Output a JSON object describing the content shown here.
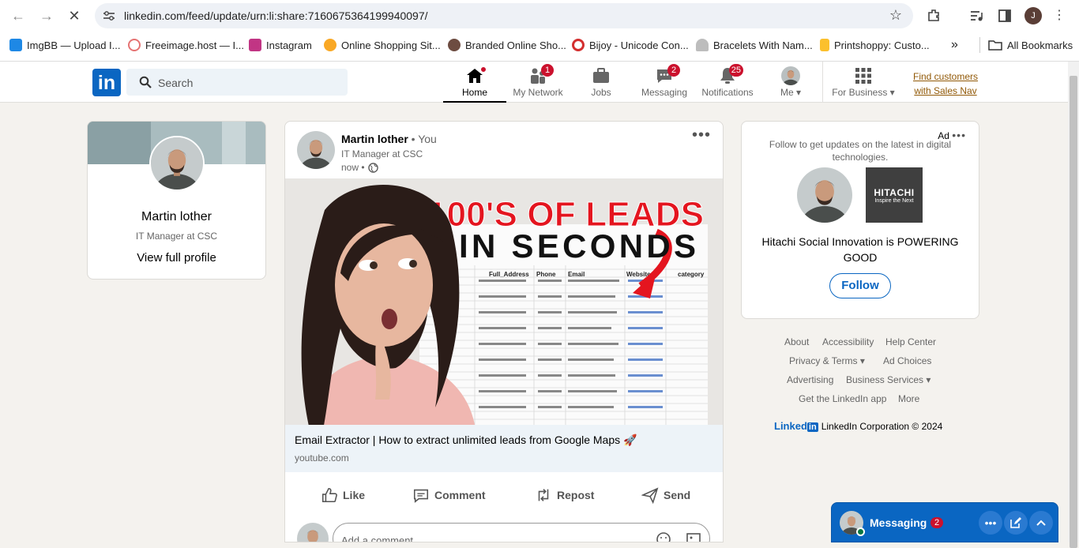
{
  "browser": {
    "url": "linkedin.com/feed/update/urn:li:share:7160675364199940097/",
    "profile_initial": "J",
    "bookmarks": [
      {
        "label": "ImgBB — Upload I...",
        "color": "#1e88e5"
      },
      {
        "label": "Freeimage.host — I...",
        "color": "#e57373"
      },
      {
        "label": "Instagram",
        "color": "#c13584"
      },
      {
        "label": "Online Shopping Sit...",
        "color": "#f9a825"
      },
      {
        "label": "Branded Online Sho...",
        "color": "#6d4c41"
      },
      {
        "label": "Bijoy - Unicode Con...",
        "color": "#d32f2f"
      },
      {
        "label": "Bracelets With Nam...",
        "color": "#9e9e9e"
      },
      {
        "label": "Printshoppy: Custo...",
        "color": "#fbc02d"
      }
    ],
    "all_bookmarks": "All Bookmarks"
  },
  "linkedin": {
    "logo": "in",
    "search_placeholder": "Search",
    "nav": [
      {
        "label": "Home",
        "badge": ""
      },
      {
        "label": "My Network",
        "badge": "1"
      },
      {
        "label": "Jobs",
        "badge": ""
      },
      {
        "label": "Messaging",
        "badge": "2"
      },
      {
        "label": "Notifications",
        "badge": "25"
      },
      {
        "label": "Me",
        "badge": ""
      },
      {
        "label": "For Business",
        "badge": ""
      }
    ],
    "promo": "Find customers with Sales Nav",
    "accent": "#0a66c2"
  },
  "profile_card": {
    "name": "Martin lother",
    "headline": "IT Manager at CSC",
    "link": "View full profile"
  },
  "post": {
    "author": "Martin lother",
    "you_tag": "• You",
    "headline": "IT Manager at CSC",
    "time": "now •",
    "thumbnail": {
      "line1": "100'S OF LEADS",
      "line2": "IN SECONDS",
      "columns": [
        "Full_Address",
        "Phone",
        "Email",
        "Website",
        "category"
      ]
    },
    "link_title": "Email Extractor | How to extract unlimited leads from Google Maps 🚀",
    "link_source": "youtube.com",
    "actions": [
      "Like",
      "Comment",
      "Repost",
      "Send"
    ],
    "comment_placeholder": "Add a comment..."
  },
  "ad": {
    "label": "Ad",
    "description": "Follow to get updates on the latest in digital technologies.",
    "company_name": "HITACHI",
    "company_tagline": "Inspire the Next",
    "title": "Hitachi Social Innovation is POWERING GOOD",
    "follow": "Follow"
  },
  "footer": {
    "links": [
      "About",
      "Accessibility",
      "Help Center",
      "Privacy & Terms",
      "Ad Choices",
      "Advertising",
      "Business Services",
      "Get the LinkedIn app",
      "More"
    ],
    "brand_word": "Linked",
    "brand_box": "in",
    "copyright": "LinkedIn Corporation © 2024"
  },
  "messaging": {
    "label": "Messaging",
    "badge": "2"
  }
}
